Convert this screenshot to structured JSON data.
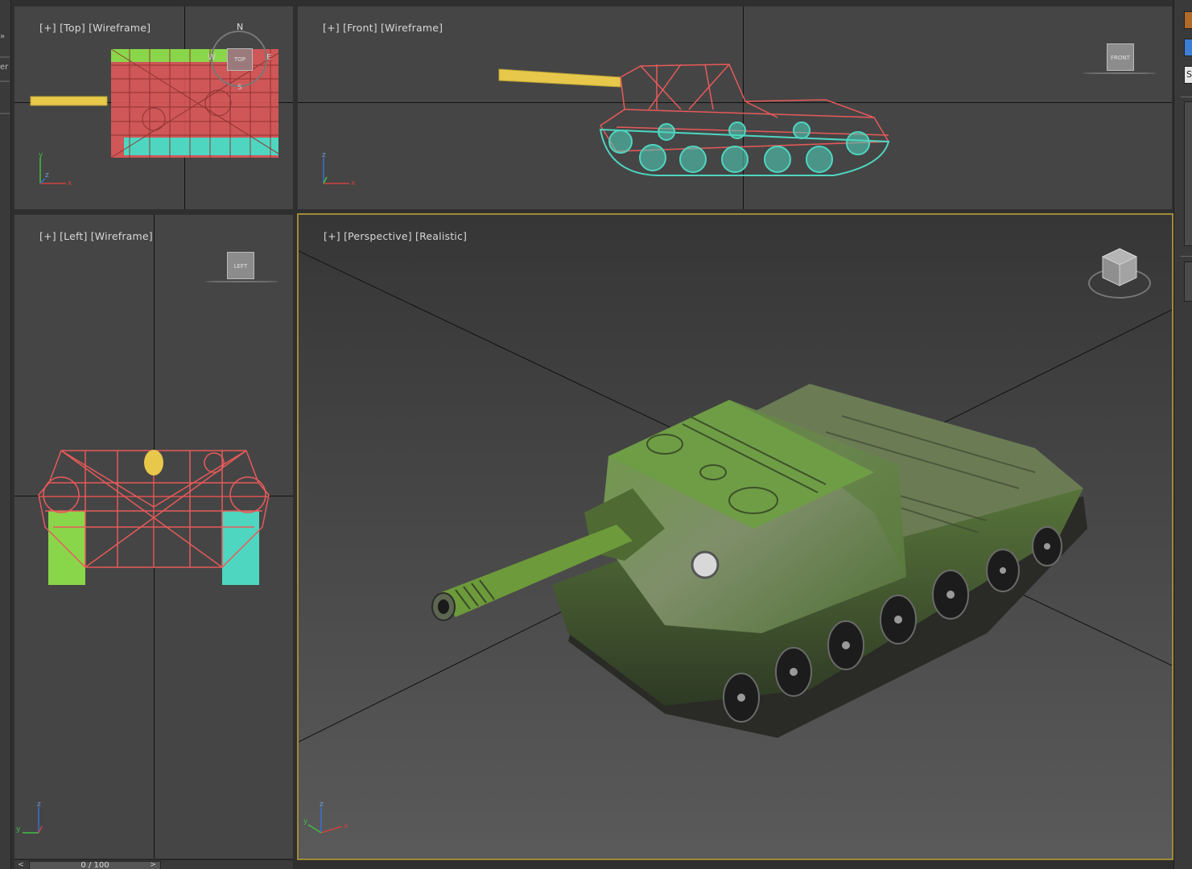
{
  "viewports": {
    "top": {
      "plus": "[+]",
      "view": "[Top]",
      "mode": "[Wireframe]"
    },
    "front": {
      "plus": "[+]",
      "view": "[Front]",
      "mode": "[Wireframe]"
    },
    "left": {
      "plus": "[+]",
      "view": "[Left]",
      "mode": "[Wireframe]"
    },
    "perspective": {
      "plus": "[+]",
      "view": "[Perspective]",
      "mode": "[Realistic]"
    }
  },
  "viewcube": {
    "top_face": "TOP",
    "front_face": "FRONT",
    "left_face": "LEFT",
    "compass_n": "N",
    "compass_s": "S",
    "compass_e": "E",
    "compass_w": "W"
  },
  "axes": {
    "x": "x",
    "y": "y",
    "z": "z"
  },
  "right_panel": {
    "field_value": "S"
  },
  "timeline": {
    "frame": "0 / 100",
    "prev": "<",
    "next": ">"
  },
  "colors": {
    "viewport_bg": "#454545",
    "active_border": "#a08a3a",
    "wire_red": "#e85a5a",
    "wire_cyan": "#4fd6c0",
    "wire_yellow": "#e8c84a",
    "wire_green": "#8ad64a",
    "tank_green": "#5f8a3a"
  },
  "icons": [
    "viewcube-icon",
    "compass-icon",
    "axis-tripod-icon",
    "tank-wireframe-top",
    "tank-wireframe-front",
    "tank-wireframe-left",
    "tank-model-3d"
  ]
}
